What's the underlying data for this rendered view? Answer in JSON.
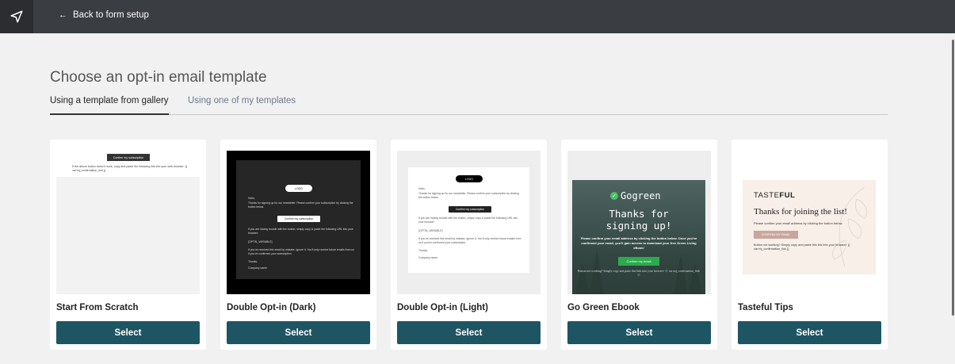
{
  "topbar": {
    "logo_icon": "paper-plane-icon",
    "back_arrow": "←",
    "back_label": "Back to form setup"
  },
  "page_title": "Choose an opt-in email template",
  "tabs": [
    {
      "label": "Using a template from gallery",
      "active": true
    },
    {
      "label": "Using one of my templates",
      "active": false
    }
  ],
  "select_label": "Select",
  "templates": [
    {
      "name": "Start From Scratch",
      "preview": {
        "button": "Confirm my subscription",
        "text": "If the above button doesn't work, copy and paste the following link into your web browser: {{ var:mj_confirmation_link }}"
      }
    },
    {
      "name": "Double Opt-in (Dark)",
      "preview": {
        "logo": "LOGO",
        "hello": "Hello,",
        "intro": "Thanks for signing up for our newsletter. Please confirm your subscription by clicking the button below.",
        "button": "Confirm my subscription",
        "trouble": "If you are having trouble with the button, simply copy & paste the following URL into your browser:",
        "variable": "[OPTIN_VARIABLE]",
        "ignore": "If you've received this email by mistake, ignore it. You'll only receive future emails from us if you've confirmed your subscription.",
        "thanks": "Thanks,",
        "company": "Company name"
      }
    },
    {
      "name": "Double Opt-in (Light)",
      "preview": {
        "logo": "LOGO",
        "hello": "Hello,",
        "intro": "Thanks for signing up for our newsletter. Please confirm your subscription by clicking the button below.",
        "button": "Confirm my subscription",
        "trouble": "If you are having trouble with the button, simply copy & paste the following URL into your browser:",
        "variable": "[OPTIN_VARIABLE]",
        "ignore": "If you've received this email by mistake, ignore it. You'll only receive future emails from us if you've confirmed your subscription.",
        "thanks": "Thanks,",
        "company": "Company name"
      }
    },
    {
      "name": "Go Green Ebook",
      "preview": {
        "logo_check": "✓",
        "logo": "Gogreen",
        "headline_1": "Thanks for",
        "headline_2": "signing up!",
        "body": "Please confirm your email address by clicking the button below. Once you've confirmed your email, you'll gain access to download your free Green Living eBook!",
        "button": "Confirm my email",
        "footer": "Button not working? Simply copy and paste this link into your browser: {{ var:mj_confirmation_link }}"
      }
    },
    {
      "name": "Tasteful Tips",
      "preview": {
        "logo_light": "TASTE",
        "logo_bold": "FUL",
        "headline": "Thanks for joining the list!",
        "sub": "Please confirm your email address by clicking the button below.",
        "button": "CONFIRM MY EMAIL",
        "footer": "Button not working? Simply copy and paste this link into your browser: {{ var:mj_confirmation_link }}"
      }
    }
  ],
  "colors": {
    "topbar": "#3a3d42",
    "select_button": "#1e5563",
    "page_bg": "#f1f1f1",
    "green_button": "#2eaa4e",
    "tasteful_button": "#c9a69d"
  }
}
